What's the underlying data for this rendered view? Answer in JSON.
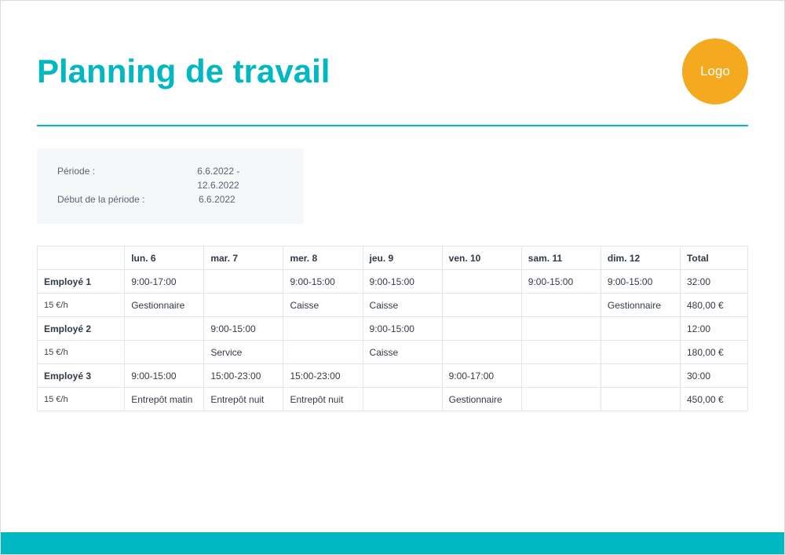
{
  "title": "Planning de travail",
  "logo_text": "Logo",
  "meta": {
    "period_label": "Période :",
    "period_value": "6.6.2022  -  12.6.2022",
    "start_label": "Début de la période :",
    "start_value": "6.6.2022"
  },
  "columns": [
    "",
    "lun. 6",
    "mar. 7",
    "mer. 8",
    "jeu. 9",
    "ven. 10",
    "sam. 11",
    "dim. 12",
    "Total"
  ],
  "employees": [
    {
      "name": "Employé 1",
      "rate": "15 €/h",
      "hours": [
        "9:00-17:00",
        "",
        "9:00-15:00",
        "9:00-15:00",
        "",
        "9:00-15:00",
        "9:00-15:00",
        "32:00"
      ],
      "roles": [
        "Gestionnaire",
        "",
        "Caisse",
        "Caisse",
        "",
        "",
        "Gestionnaire",
        "480,00 €"
      ]
    },
    {
      "name": "Employé 2",
      "rate": "15 €/h",
      "hours": [
        "",
        "9:00-15:00",
        "",
        "9:00-15:00",
        "",
        "",
        "",
        "12:00"
      ],
      "roles": [
        "",
        "Service",
        "",
        "Caisse",
        "",
        "",
        "",
        "180,00 €"
      ]
    },
    {
      "name": "Employé 3",
      "rate": "15 €/h",
      "hours": [
        "9:00-15:00",
        "15:00-23:00",
        "15:00-23:00",
        "",
        "9:00-17:00",
        "",
        "",
        "30:00"
      ],
      "roles": [
        "Entrepôt matin",
        "Entrepôt nuit",
        "Entrepôt nuit",
        "",
        "Gestionnaire",
        "",
        "",
        "450,00 €"
      ]
    }
  ]
}
